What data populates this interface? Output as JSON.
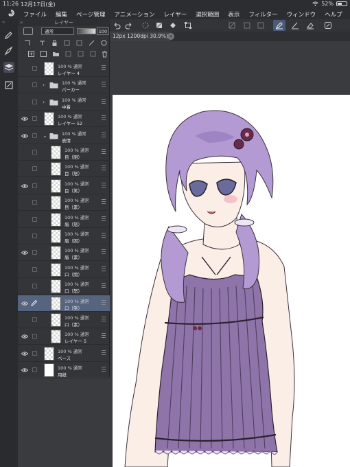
{
  "status": {
    "time": "11:26",
    "date": "12月17日(金)",
    "battery": "52%",
    "battery_level": 0.52
  },
  "menu": {
    "items": [
      "ファイル",
      "編集",
      "ページ管理",
      "アニメーション",
      "レイヤー",
      "選択範囲",
      "表示",
      "フィルター",
      "ウィンドウ",
      "ヘルプ"
    ]
  },
  "doc_tab": {
    "title": "12px 1200dpi 30.9%)"
  },
  "layer_panel": {
    "title": "レイヤー",
    "blend_mode": "通常",
    "opacity": "100",
    "layers": [
      {
        "meta": "100 % 通常",
        "name": "レイヤー 4",
        "kind": "raster",
        "eye": false,
        "indent": 0
      },
      {
        "meta": "100 % 通常",
        "name": "パーカー",
        "kind": "folder",
        "eye": false,
        "indent": 0,
        "arrow": "›"
      },
      {
        "meta": "100 % 通常",
        "name": "中着",
        "kind": "folder",
        "eye": false,
        "indent": 0,
        "arrow": "›"
      },
      {
        "meta": "100 % 通常",
        "name": "レイヤー 52",
        "kind": "raster",
        "eye": true,
        "indent": 0
      },
      {
        "meta": "100 % 通常",
        "name": "表情",
        "kind": "folder",
        "eye": true,
        "indent": 0,
        "arrow": "⌄"
      },
      {
        "meta": "100 % 通常",
        "name": "目（閉）",
        "kind": "raster",
        "eye": false,
        "indent": 1
      },
      {
        "meta": "100 % 通常",
        "name": "目（怒）",
        "kind": "raster",
        "eye": false,
        "indent": 1
      },
      {
        "meta": "100 % 通常",
        "name": "目（笑）",
        "kind": "raster",
        "eye": true,
        "indent": 1
      },
      {
        "meta": "100 % 通常",
        "name": "目（素）",
        "kind": "raster",
        "eye": false,
        "indent": 1
      },
      {
        "meta": "100 % 通常",
        "name": "眉（怒）",
        "kind": "raster",
        "eye": false,
        "indent": 1
      },
      {
        "meta": "100 % 通常",
        "name": "眉（困）",
        "kind": "raster",
        "eye": false,
        "indent": 1
      },
      {
        "meta": "100 % 通常",
        "name": "眉（素）",
        "kind": "raster",
        "eye": true,
        "indent": 1
      },
      {
        "meta": "100 % 通常",
        "name": "口（開）",
        "kind": "raster",
        "eye": false,
        "indent": 1
      },
      {
        "meta": "100 % 通常",
        "name": "口（怒）",
        "kind": "raster",
        "eye": false,
        "indent": 1
      },
      {
        "meta": "100 % 通常",
        "name": "口（笑）",
        "kind": "raster",
        "eye": true,
        "indent": 1,
        "selected": true
      },
      {
        "meta": "100 % 通常",
        "name": "口（素）",
        "kind": "raster",
        "eye": false,
        "indent": 1
      },
      {
        "meta": "100 % 通常",
        "name": "レイヤー 5",
        "kind": "raster",
        "eye": true,
        "indent": 1
      },
      {
        "meta": "100 % 通常",
        "name": "ベース",
        "kind": "raster",
        "eye": true,
        "indent": 0
      },
      {
        "meta": "100 % 通常",
        "name": "用紙",
        "kind": "paper",
        "eye": true,
        "indent": 0
      }
    ]
  },
  "colors": {
    "hair": "#b39ad3",
    "hair_shadow": "#8f77b8",
    "skin": "#fbeee7",
    "skin_blush": "#f4b8c2",
    "dress": "#8e74a8",
    "dress_dark": "#6d5888",
    "accessory": "#6b2a4a",
    "eyes": "#6a6a9c",
    "selected_layer": "#56647f",
    "active_tool": "#4b5a78"
  }
}
